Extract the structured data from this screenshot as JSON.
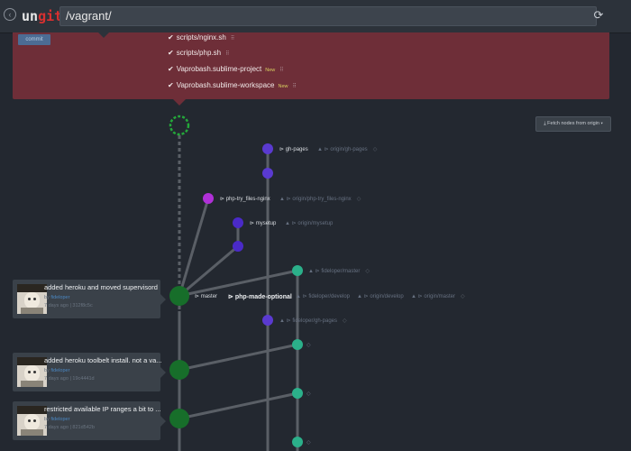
{
  "header": {
    "logo_prefix": "un",
    "logo_suffix": "git",
    "path": "/vagrant/"
  },
  "panel": {
    "commit_label": "commit",
    "files": [
      {
        "name": "scripts/nginx.sh",
        "tag": ""
      },
      {
        "name": "scripts/php.sh",
        "tag": ""
      },
      {
        "name": "Vaprobash.sublime-project",
        "tag": "New"
      },
      {
        "name": "Vaprobash.sublime-workspace",
        "tag": "New"
      }
    ]
  },
  "fetch_button": "Fetch nodes from origin",
  "refs": {
    "gh_pages": "gh-pages",
    "origin_gh_pages": "origin/gh-pages",
    "php_try_files": "php-try_files-nginx",
    "origin_php_try_files": "origin/php-try_files-nginx",
    "mysetup": "mysetup",
    "origin_mysetup": "origin/mysetup",
    "fideloper_master": "fideloper/master",
    "master": "master",
    "php_made_optional": "php-made-optional",
    "fideloper_develop": "fideloper/develop",
    "origin_develop": "origin/develop",
    "origin_master": "origin/master",
    "fideloper_gh_pages": "fideloper/gh-pages"
  },
  "commits": [
    {
      "title": "added heroku and moved supervisord",
      "author": "fideloper",
      "age": "7 days ago",
      "hash": "312f8c5c"
    },
    {
      "title": "added heroku toolbelt install. not a va...",
      "author": "fideloper",
      "age": "7 days ago",
      "hash": "19c4441d"
    },
    {
      "title": "restricted available IP ranges a bit to ...",
      "author": "fideloper",
      "age": "7 days ago",
      "hash": "821d542b"
    }
  ],
  "labels": {
    "by": "by"
  },
  "colors": {
    "head_green": "#176e2a",
    "dark_green": "#1c8a2c",
    "teal": "#2bb08a",
    "purple": "#5a3ad0",
    "magenta": "#b030d8"
  }
}
